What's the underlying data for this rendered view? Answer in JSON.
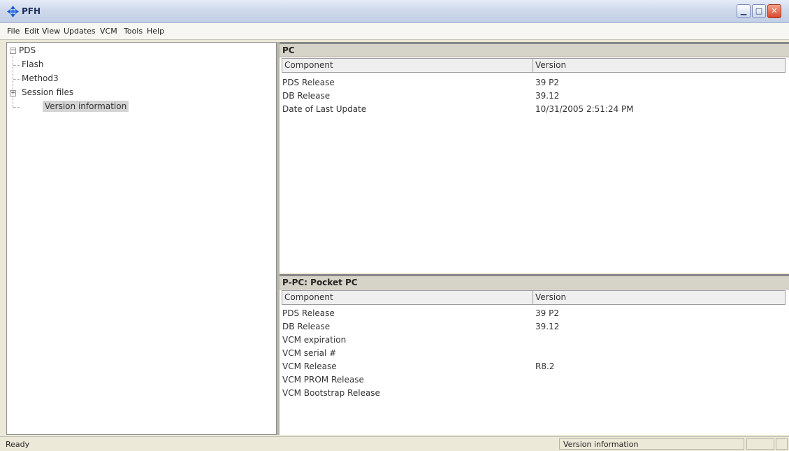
{
  "window": {
    "title": "PFH"
  },
  "menu": [
    "File",
    "Edit",
    "View",
    "Updates",
    "VCM",
    "Tools",
    "Help"
  ],
  "tree": {
    "root": "PDS",
    "children": [
      "Flash",
      "Method3",
      "Session files",
      "Version information"
    ],
    "selected": "Version information"
  },
  "pc_panel": {
    "title": "PC",
    "columns": [
      "Component",
      "Version"
    ],
    "rows": [
      [
        "PDS Release",
        "39 P2"
      ],
      [
        "DB Release",
        "39.12"
      ],
      [
        "Date of Last Update",
        "10/31/2005 2:51:24 PM"
      ]
    ]
  },
  "ppc_panel": {
    "title": "P-PC: Pocket PC",
    "columns": [
      "Component",
      "Version"
    ],
    "rows": [
      [
        "PDS Release",
        "39 P2"
      ],
      [
        "DB Release",
        "39.12"
      ],
      [
        "VCM expiration",
        ""
      ],
      [
        "VCM serial #",
        ""
      ],
      [
        "VCM Release",
        "R8.2"
      ],
      [
        "VCM PROM Release",
        ""
      ],
      [
        "VCM Bootstrap Release",
        ""
      ]
    ]
  },
  "status": {
    "left": "Ready",
    "right": "Version information"
  },
  "colors": {
    "titlebar": "#cfd9ec",
    "close_button": "#d9492c",
    "selection": "#d4d4d4"
  }
}
